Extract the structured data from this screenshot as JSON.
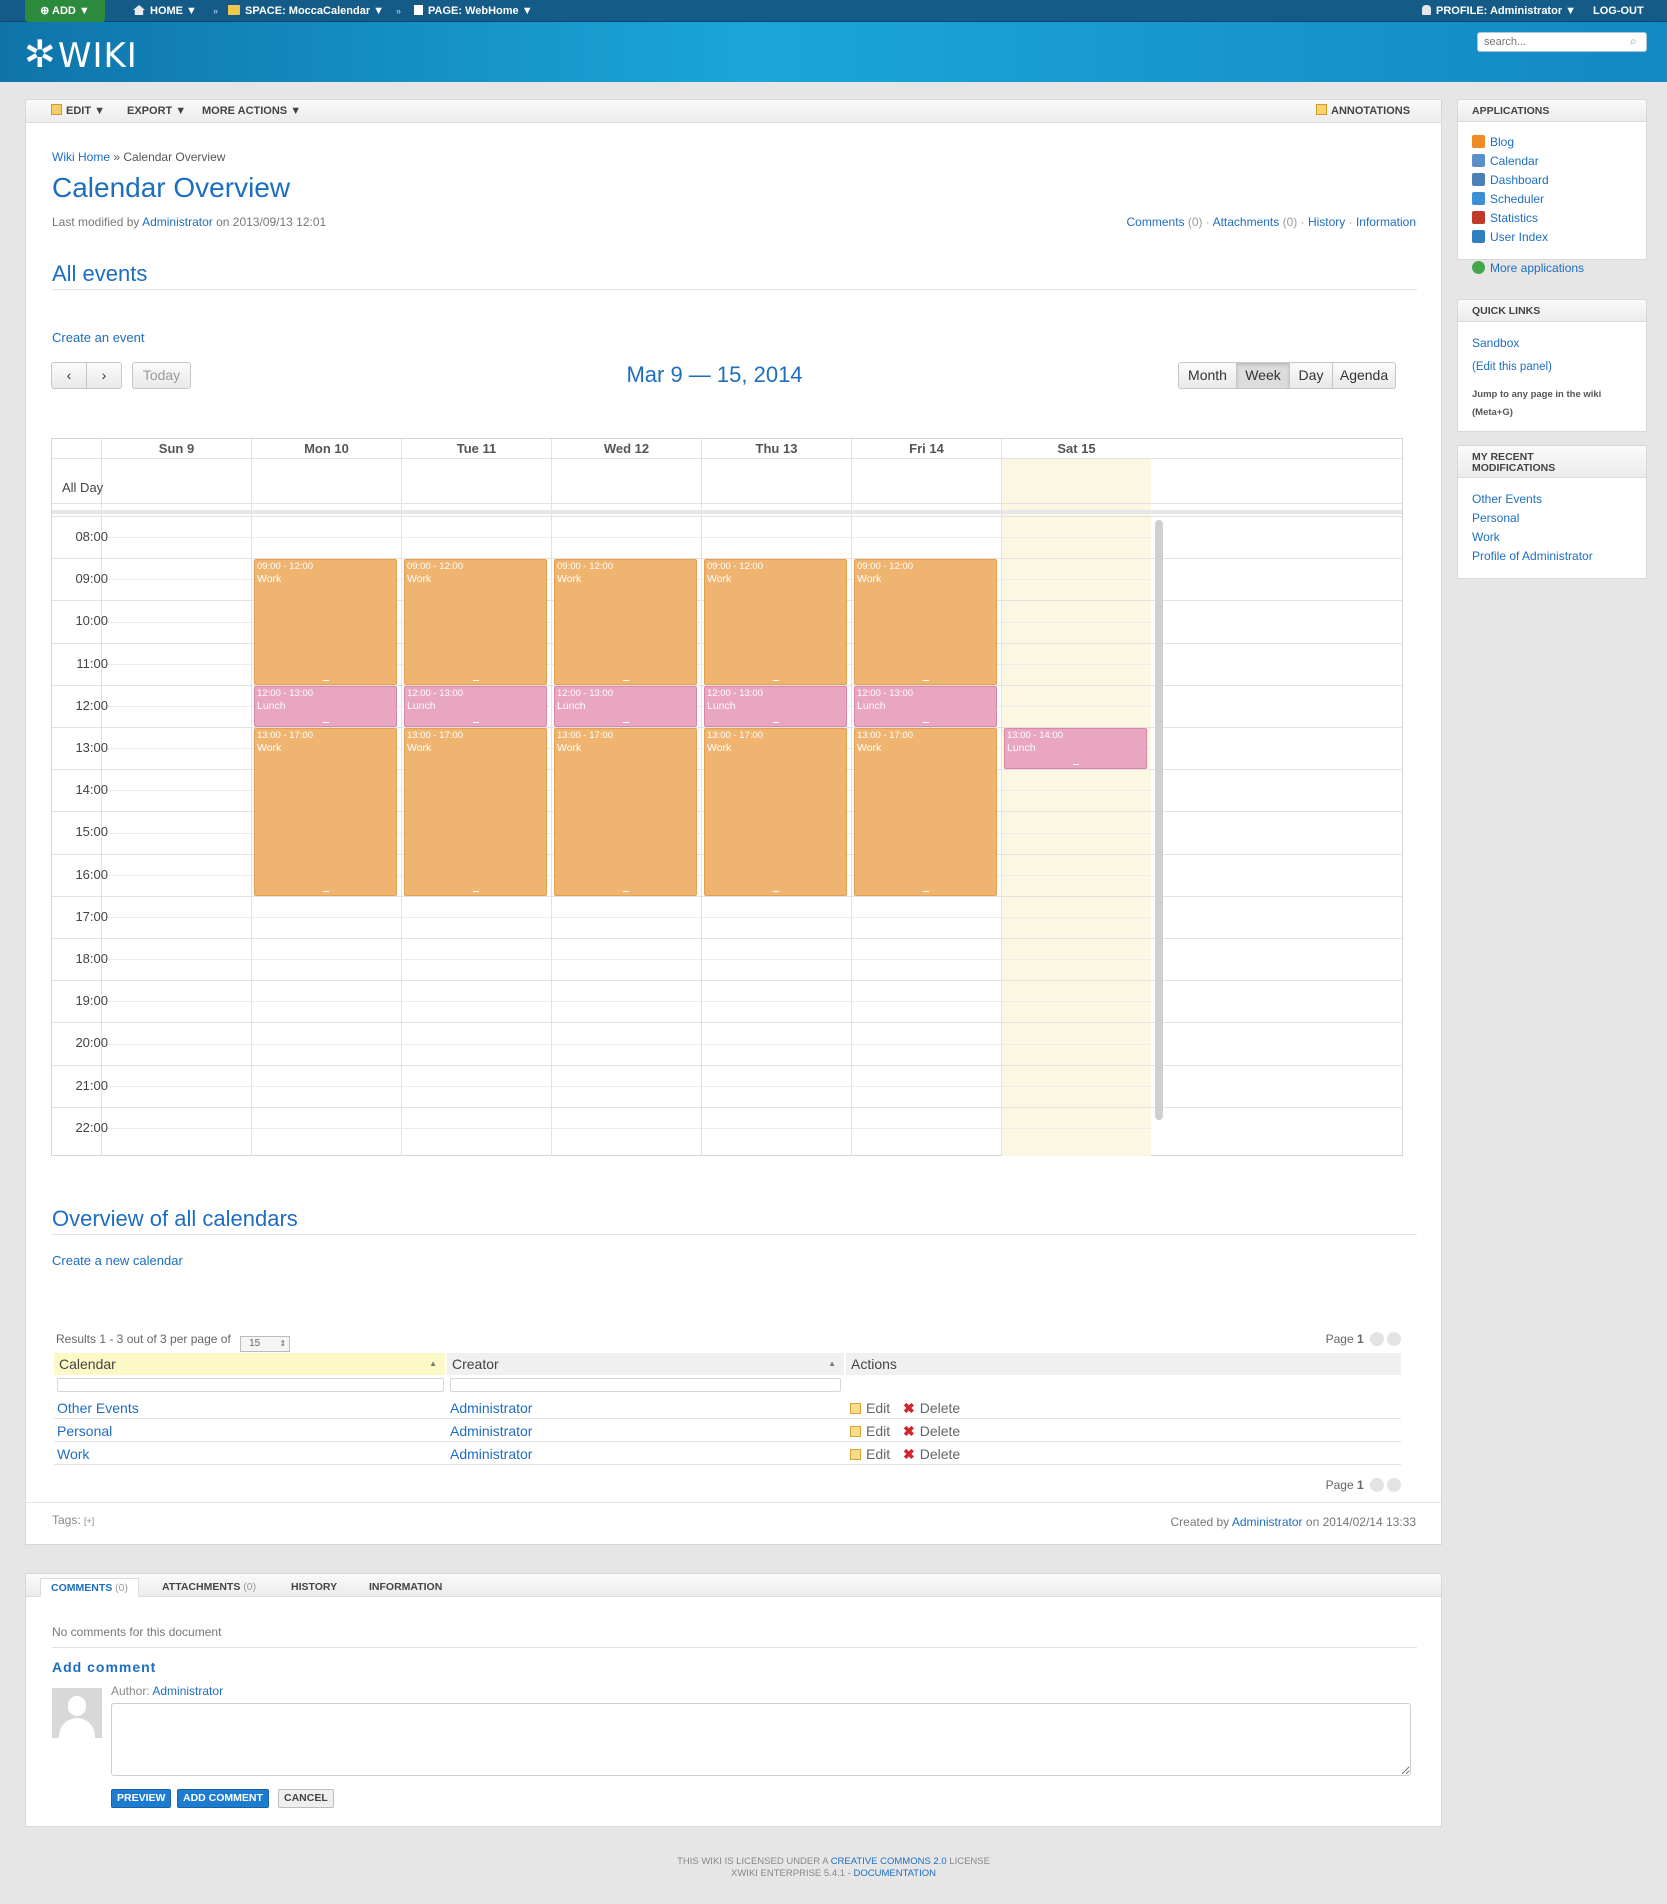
{
  "topbar": {
    "add": "ADD",
    "home": "HOME",
    "space": "SPACE: MoccaCalendar",
    "page": "PAGE: WebHome",
    "profile": "PROFILE: Administrator",
    "logout": "LOG-OUT"
  },
  "header": {
    "logo": "WIKI",
    "search_placeholder": "search..."
  },
  "menubar": {
    "edit": "EDIT",
    "export": "EXPORT",
    "more_actions": "MORE ACTIONS",
    "annotations": "ANNOTATIONS"
  },
  "breadcrumb": {
    "home": "Wiki Home",
    "sep": "»",
    "current": "Calendar Overview"
  },
  "page": {
    "title": "Calendar Overview",
    "modified_prefix": "Last modified by",
    "modified_user": "Administrator",
    "modified_date": "on 2013/09/13 12:01",
    "links": {
      "comments": "Comments",
      "comments_count": "(0)",
      "attachments": "Attachments",
      "attachments_count": "(0)",
      "history": "History",
      "information": "Information"
    }
  },
  "events_section": {
    "heading": "All events",
    "create_link": "Create an event"
  },
  "calendar": {
    "title": "Mar 9 — 15, 2014",
    "today": "Today",
    "views": [
      "Month",
      "Week",
      "Day",
      "Agenda"
    ],
    "active_view": "Week",
    "allday_label": "All Day",
    "days": [
      "Sun 9",
      "Mon 10",
      "Tue 11",
      "Wed 12",
      "Thu 13",
      "Fri 14",
      "Sat 15"
    ],
    "hours": [
      "08:00",
      "09:00",
      "10:00",
      "11:00",
      "12:00",
      "13:00",
      "14:00",
      "15:00",
      "16:00",
      "17:00",
      "18:00",
      "19:00",
      "20:00",
      "21:00",
      "22:00"
    ],
    "events": [
      {
        "day": 1,
        "start": 9,
        "end": 12,
        "time": "09:00 - 12:00",
        "title": "Work",
        "kind": "work"
      },
      {
        "day": 2,
        "start": 9,
        "end": 12,
        "time": "09:00 - 12:00",
        "title": "Work",
        "kind": "work"
      },
      {
        "day": 3,
        "start": 9,
        "end": 12,
        "time": "09:00 - 12:00",
        "title": "Work",
        "kind": "work"
      },
      {
        "day": 4,
        "start": 9,
        "end": 12,
        "time": "09:00 - 12:00",
        "title": "Work",
        "kind": "work"
      },
      {
        "day": 5,
        "start": 9,
        "end": 12,
        "time": "09:00 - 12:00",
        "title": "Work",
        "kind": "work"
      },
      {
        "day": 1,
        "start": 12,
        "end": 13,
        "time": "12:00 - 13:00",
        "title": "Lunch",
        "kind": "lunch"
      },
      {
        "day": 2,
        "start": 12,
        "end": 13,
        "time": "12:00 - 13:00",
        "title": "Lunch",
        "kind": "lunch"
      },
      {
        "day": 3,
        "start": 12,
        "end": 13,
        "time": "12:00 - 13:00",
        "title": "Lunch",
        "kind": "lunch"
      },
      {
        "day": 4,
        "start": 12,
        "end": 13,
        "time": "12:00 - 13:00",
        "title": "Lunch",
        "kind": "lunch"
      },
      {
        "day": 5,
        "start": 12,
        "end": 13,
        "time": "12:00 - 13:00",
        "title": "Lunch",
        "kind": "lunch"
      },
      {
        "day": 1,
        "start": 13,
        "end": 17,
        "time": "13:00 - 17:00",
        "title": "Work",
        "kind": "work"
      },
      {
        "day": 2,
        "start": 13,
        "end": 17,
        "time": "13:00 - 17:00",
        "title": "Work",
        "kind": "work"
      },
      {
        "day": 3,
        "start": 13,
        "end": 17,
        "time": "13:00 - 17:00",
        "title": "Work",
        "kind": "work"
      },
      {
        "day": 4,
        "start": 13,
        "end": 17,
        "time": "13:00 - 17:00",
        "title": "Work",
        "kind": "work"
      },
      {
        "day": 5,
        "start": 13,
        "end": 17,
        "time": "13:00 - 17:00",
        "title": "Work",
        "kind": "work"
      },
      {
        "day": 6,
        "start": 13,
        "end": 14,
        "time": "13:00 - 14:00",
        "title": "Lunch",
        "kind": "lunch"
      }
    ],
    "colors": {
      "work": "#efb570",
      "lunch": "#e9a6c0",
      "weekend": "#fbf7e2"
    }
  },
  "overview": {
    "heading": "Overview of all calendars",
    "create_link": "Create a new calendar",
    "results_text": "Results 1 - 3 out of 3 per page of",
    "per_page": "15",
    "page_label": "Page",
    "page_num": "1",
    "columns": [
      "Calendar",
      "Creator",
      "Actions"
    ],
    "rows": [
      {
        "calendar": "Other Events",
        "creator": "Administrator"
      },
      {
        "calendar": "Personal",
        "creator": "Administrator"
      },
      {
        "calendar": "Work",
        "creator": "Administrator"
      }
    ],
    "edit": "Edit",
    "delete": "Delete"
  },
  "tags": {
    "label": "Tags:",
    "add": "[+]"
  },
  "created": {
    "prefix": "Created by",
    "user": "Administrator",
    "date": "on 2014/02/14 13:33"
  },
  "doc_tabs": {
    "comments": "COMMENTS",
    "comments_count": "(0)",
    "attachments": "ATTACHMENTS",
    "attachments_count": "(0)",
    "history": "HISTORY",
    "information": "INFORMATION"
  },
  "comments": {
    "none": "No comments for this document",
    "add_heading": "Add comment",
    "author_label": "Author:",
    "author": "Administrator",
    "preview": "PREVIEW",
    "add": "ADD COMMENT",
    "cancel": "CANCEL"
  },
  "sidebar": {
    "applications": {
      "title": "APPLICATIONS",
      "items": [
        "Blog",
        "Calendar",
        "Dashboard",
        "Scheduler",
        "Statistics",
        "User Index"
      ],
      "more": "More applications"
    },
    "quick_links": {
      "title": "QUICK LINKS",
      "sandbox": "Sandbox",
      "edit_panel": "(Edit this panel)",
      "jump": "Jump to any page in the wiki",
      "jump_key": "(Meta+G)"
    },
    "recent": {
      "title1": "MY RECENT",
      "title2": "MODIFICATIONS",
      "items": [
        "Other Events",
        "Personal",
        "Work",
        "Profile of Administrator"
      ]
    }
  },
  "footer": {
    "line1_pre": "THIS WIKI IS LICENSED UNDER A",
    "license": "CREATIVE COMMONS 2.0",
    "line1_post": "LICENSE",
    "line2_pre": "XWIKI ENTERPRISE 5.4.1 -",
    "docs": "DOCUMENTATION"
  }
}
